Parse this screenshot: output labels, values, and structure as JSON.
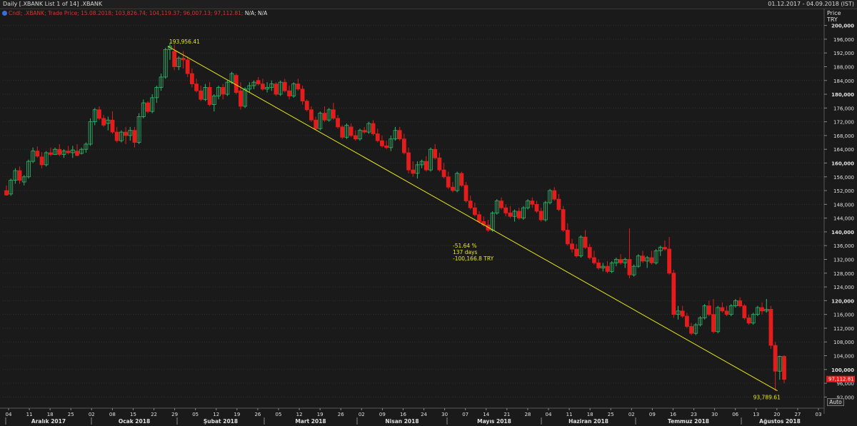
{
  "header": {
    "title": "Daily [.XBANK List 1 of 14] .XBANK",
    "date_range": "01.12.2017 - 04.09.2018 (IST)"
  },
  "legend": {
    "icon": "circle-icon",
    "series_text": "Cndl; .XBANK; Trade Price; 15.08.2018; 103,826.74; 104,119.37; 96,007.13; 97,112.81;",
    "na_text": "N/A; N/A"
  },
  "colors": {
    "up": "#2fb96a",
    "down": "#e41c1c",
    "trendline": "#e8e81a",
    "grid": "#3a3a3a",
    "background": "#1a1a1a",
    "text": "#e0e0e0"
  },
  "axis": {
    "price_label": "Price",
    "currency_label": "TRY",
    "auto_label": "Auto"
  },
  "chart_data": {
    "type": "candlestick",
    "title": "Daily [.XBANK List 1 of 14] .XBANK",
    "ylabel": "Price TRY",
    "ylim": [
      90000,
      202000
    ],
    "y_ticks": [
      92000,
      96000,
      100000,
      104000,
      108000,
      112000,
      116000,
      120000,
      124000,
      128000,
      132000,
      136000,
      140000,
      144000,
      148000,
      152000,
      156000,
      160000,
      164000,
      168000,
      172000,
      176000,
      180000,
      184000,
      188000,
      192000,
      196000,
      200000
    ],
    "x_ticks": [
      "04",
      "11",
      "18",
      "25",
      "02",
      "08",
      "15",
      "22",
      "29",
      "05",
      "12",
      "19",
      "26",
      "05",
      "12",
      "19",
      "26",
      "02",
      "09",
      "16",
      "24",
      "30",
      "07",
      "14",
      "21",
      "28",
      "04",
      "11",
      "18",
      "25",
      "02",
      "09",
      "16",
      "23",
      "30",
      "06",
      "13",
      "20",
      "27",
      "03"
    ],
    "months": [
      "Aralık 2017",
      "Ocak 2018",
      "Şubat 2018",
      "Mart 2018",
      "Nisan 2018",
      "Mayıs 2018",
      "Haziran 2018",
      "Temmuz 2018",
      "Ağustos 2018"
    ],
    "last_price_label": "97,112.81",
    "annotations": {
      "high_label": "193,956.41",
      "low_label": "93,789.61",
      "change_pct": "-51.64 %",
      "duration": "137 days",
      "change_abs": "-100,166.8 TRY"
    },
    "trendline": {
      "from": 193956.41,
      "to": 93789.61
    },
    "candles": [
      [
        152000,
        153500,
        150500,
        150700
      ],
      [
        151000,
        155500,
        150500,
        155000
      ],
      [
        155000,
        158500,
        154000,
        157800
      ],
      [
        157800,
        159000,
        154000,
        155000
      ],
      [
        154500,
        156500,
        153500,
        156000
      ],
      [
        156000,
        161000,
        155500,
        160500
      ],
      [
        160500,
        164500,
        160000,
        163500
      ],
      [
        163500,
        164800,
        161500,
        162000
      ],
      [
        161800,
        163200,
        158500,
        159500
      ],
      [
        159500,
        163500,
        159000,
        163000
      ],
      [
        163000,
        164500,
        162000,
        162500
      ],
      [
        162500,
        164500,
        162500,
        164000
      ],
      [
        164000,
        165500,
        162000,
        162500
      ],
      [
        162500,
        164000,
        161500,
        163500
      ],
      [
        163500,
        165000,
        162500,
        163000
      ],
      [
        163000,
        165000,
        161500,
        163800
      ],
      [
        163500,
        165500,
        162000,
        162200
      ],
      [
        162800,
        164500,
        162500,
        164000
      ],
      [
        164000,
        166000,
        163000,
        165500
      ],
      [
        165500,
        173000,
        165000,
        172000
      ],
      [
        172000,
        176000,
        171000,
        175500
      ],
      [
        175500,
        176500,
        172500,
        173000
      ],
      [
        173000,
        174000,
        170500,
        171000
      ],
      [
        171500,
        173500,
        169500,
        172500
      ],
      [
        172500,
        175000,
        168500,
        169000
      ],
      [
        169000,
        170500,
        166000,
        166500
      ],
      [
        166500,
        169500,
        166000,
        169000
      ],
      [
        169000,
        170500,
        165500,
        168000
      ],
      [
        168000,
        170500,
        166500,
        169500
      ],
      [
        169500,
        170500,
        164500,
        166000
      ],
      [
        166000,
        174500,
        165500,
        173500
      ],
      [
        173500,
        178500,
        173000,
        177500
      ],
      [
        177500,
        178000,
        174500,
        175000
      ],
      [
        175000,
        180000,
        174500,
        179000
      ],
      [
        179000,
        182500,
        177500,
        182000
      ],
      [
        182000,
        186000,
        181000,
        185000
      ],
      [
        185000,
        193500,
        184500,
        193000
      ],
      [
        193000,
        195000,
        190000,
        193956
      ],
      [
        192500,
        194500,
        187000,
        188000
      ],
      [
        188000,
        191000,
        187000,
        190500
      ],
      [
        190500,
        192500,
        187500,
        190000
      ],
      [
        190000,
        191000,
        185000,
        186000
      ],
      [
        186000,
        187500,
        182000,
        183000
      ],
      [
        183000,
        184500,
        180500,
        181000
      ],
      [
        181000,
        182500,
        178000,
        178500
      ],
      [
        178500,
        183000,
        178000,
        182000
      ],
      [
        182000,
        183500,
        176500,
        177000
      ],
      [
        177000,
        180000,
        175000,
        179500
      ],
      [
        179500,
        182500,
        178500,
        182000
      ],
      [
        182000,
        183000,
        178500,
        180000
      ],
      [
        180000,
        184000,
        179500,
        183500
      ],
      [
        183500,
        186500,
        183000,
        186000
      ],
      [
        185500,
        186000,
        180000,
        180500
      ],
      [
        181000,
        183500,
        175500,
        176500
      ],
      [
        176500,
        182000,
        176000,
        181500
      ],
      [
        181500,
        183500,
        180500,
        182500
      ],
      [
        182500,
        184000,
        181500,
        183500
      ],
      [
        184000,
        185000,
        182500,
        183000
      ],
      [
        183000,
        184500,
        181000,
        181500
      ],
      [
        181500,
        183500,
        180500,
        182000
      ],
      [
        182000,
        184000,
        181000,
        183000
      ],
      [
        183000,
        183500,
        179500,
        180000
      ],
      [
        180000,
        184000,
        179500,
        183500
      ],
      [
        183500,
        184500,
        180500,
        181000
      ],
      [
        181000,
        182500,
        178500,
        179500
      ],
      [
        179500,
        183500,
        179000,
        183000
      ],
      [
        183000,
        184500,
        181000,
        181500
      ],
      [
        181500,
        182500,
        177000,
        178000
      ],
      [
        178000,
        178500,
        175000,
        175500
      ],
      [
        175500,
        176500,
        172000,
        172500
      ],
      [
        172500,
        173500,
        169500,
        170000
      ],
      [
        170000,
        175000,
        169500,
        174500
      ],
      [
        174500,
        176500,
        172000,
        172500
      ],
      [
        172500,
        176000,
        172000,
        175500
      ],
      [
        175500,
        177500,
        172500,
        173000
      ],
      [
        173000,
        174000,
        170000,
        170500
      ],
      [
        170500,
        171000,
        167000,
        167500
      ],
      [
        167500,
        171500,
        167000,
        171000
      ],
      [
        170500,
        171500,
        167500,
        168000
      ],
      [
        168000,
        169500,
        166500,
        167000
      ],
      [
        167000,
        170000,
        166500,
        169500
      ],
      [
        169500,
        170500,
        168500,
        169000
      ],
      [
        169000,
        172000,
        168500,
        171500
      ],
      [
        171500,
        172500,
        168000,
        168500
      ],
      [
        168500,
        170000,
        166000,
        166500
      ],
      [
        166500,
        168000,
        164500,
        165000
      ],
      [
        165000,
        166500,
        164000,
        164500
      ],
      [
        164500,
        168000,
        163500,
        167000
      ],
      [
        167000,
        170500,
        166500,
        169500
      ],
      [
        169500,
        170500,
        166500,
        167000
      ],
      [
        167000,
        168500,
        162500,
        163000
      ],
      [
        163000,
        164500,
        157000,
        158000
      ],
      [
        158000,
        160500,
        156000,
        157000
      ],
      [
        157000,
        160500,
        155500,
        159500
      ],
      [
        159500,
        161000,
        158500,
        160500
      ],
      [
        160500,
        162000,
        157500,
        158000
      ],
      [
        158000,
        164500,
        157500,
        164000
      ],
      [
        164000,
        165500,
        161000,
        161500
      ],
      [
        161500,
        163000,
        157500,
        158000
      ],
      [
        158000,
        160000,
        155500,
        156000
      ],
      [
        156000,
        157500,
        152500,
        153000
      ],
      [
        153000,
        154500,
        151500,
        152000
      ],
      [
        152000,
        157500,
        151500,
        157000
      ],
      [
        157000,
        157500,
        153000,
        153500
      ],
      [
        153500,
        154500,
        148500,
        149000
      ],
      [
        149000,
        150500,
        146500,
        147000
      ],
      [
        147000,
        148500,
        144500,
        145000
      ],
      [
        145000,
        146000,
        142500,
        143000
      ],
      [
        143000,
        144500,
        141500,
        142000
      ],
      [
        142000,
        143500,
        140000,
        140500
      ],
      [
        140500,
        146000,
        140000,
        145500
      ],
      [
        145500,
        149500,
        145000,
        149000
      ],
      [
        149000,
        150000,
        146500,
        147000
      ],
      [
        147000,
        148000,
        144500,
        145500
      ],
      [
        145500,
        147500,
        144000,
        144500
      ],
      [
        144500,
        146500,
        143000,
        146000
      ],
      [
        146000,
        147000,
        143500,
        144000
      ],
      [
        144000,
        147500,
        143500,
        147000
      ],
      [
        147000,
        149500,
        146500,
        149000
      ],
      [
        149000,
        150000,
        147000,
        148000
      ],
      [
        148000,
        149000,
        145500,
        146000
      ],
      [
        146000,
        147000,
        143000,
        143500
      ],
      [
        143500,
        149000,
        143000,
        148500
      ],
      [
        148500,
        152500,
        148000,
        152000
      ],
      [
        152000,
        153000,
        149000,
        149500
      ],
      [
        149500,
        151000,
        146000,
        146500
      ],
      [
        146500,
        147500,
        140000,
        140500
      ],
      [
        140500,
        142500,
        136000,
        136500
      ],
      [
        136500,
        138000,
        134000,
        135000
      ],
      [
        135000,
        136500,
        132500,
        133000
      ],
      [
        133000,
        139000,
        132500,
        138500
      ],
      [
        138500,
        140500,
        135000,
        135500
      ],
      [
        135500,
        136500,
        132000,
        132500
      ],
      [
        132500,
        134500,
        130500,
        131000
      ],
      [
        131000,
        132000,
        129000,
        129500
      ],
      [
        129500,
        131000,
        128500,
        130000
      ],
      [
        130000,
        131500,
        128000,
        128500
      ],
      [
        128500,
        131500,
        128000,
        131000
      ],
      [
        131000,
        132500,
        130000,
        132000
      ],
      [
        132000,
        133500,
        130500,
        131000
      ],
      [
        131000,
        132500,
        129500,
        132000
      ],
      [
        132000,
        141000,
        126500,
        127500
      ],
      [
        127500,
        130500,
        127000,
        130000
      ],
      [
        130000,
        133500,
        129500,
        133000
      ],
      [
        133000,
        134500,
        131000,
        131500
      ],
      [
        131500,
        133000,
        129500,
        132500
      ],
      [
        132500,
        134500,
        130500,
        131000
      ],
      [
        131000,
        135000,
        130500,
        134500
      ],
      [
        134500,
        136000,
        133000,
        135500
      ],
      [
        135500,
        137500,
        134500,
        135000
      ],
      [
        135000,
        138500,
        127500,
        128000
      ],
      [
        128000,
        129000,
        115000,
        116000
      ],
      [
        116000,
        118500,
        114500,
        117000
      ],
      [
        117000,
        118500,
        115000,
        115500
      ],
      [
        115500,
        116500,
        112000,
        112500
      ],
      [
        112500,
        113500,
        110000,
        110500
      ],
      [
        110500,
        113500,
        110000,
        113000
      ],
      [
        113000,
        115500,
        112500,
        115000
      ],
      [
        115000,
        119000,
        114500,
        118500
      ],
      [
        118500,
        120000,
        115500,
        116000
      ],
      [
        116000,
        120500,
        110500,
        111000
      ],
      [
        111000,
        118500,
        110500,
        118000
      ],
      [
        118000,
        119500,
        116500,
        117000
      ],
      [
        117000,
        118500,
        115500,
        116000
      ],
      [
        116000,
        119000,
        115500,
        118500
      ],
      [
        118500,
        120500,
        118000,
        120000
      ],
      [
        120000,
        121000,
        118000,
        118500
      ],
      [
        118500,
        119000,
        114500,
        115000
      ],
      [
        115000,
        116000,
        113000,
        113500
      ],
      [
        113500,
        116500,
        113000,
        116000
      ],
      [
        116000,
        118500,
        115500,
        118000
      ],
      [
        118000,
        119500,
        116000,
        117000
      ],
      [
        117000,
        120500,
        116500,
        117500
      ],
      [
        117500,
        118500,
        106000,
        107000
      ],
      [
        107000,
        108000,
        93789,
        99500
      ],
      [
        99500,
        104000,
        97000,
        103800
      ],
      [
        103826,
        104119,
        96007,
        97113
      ]
    ]
  }
}
